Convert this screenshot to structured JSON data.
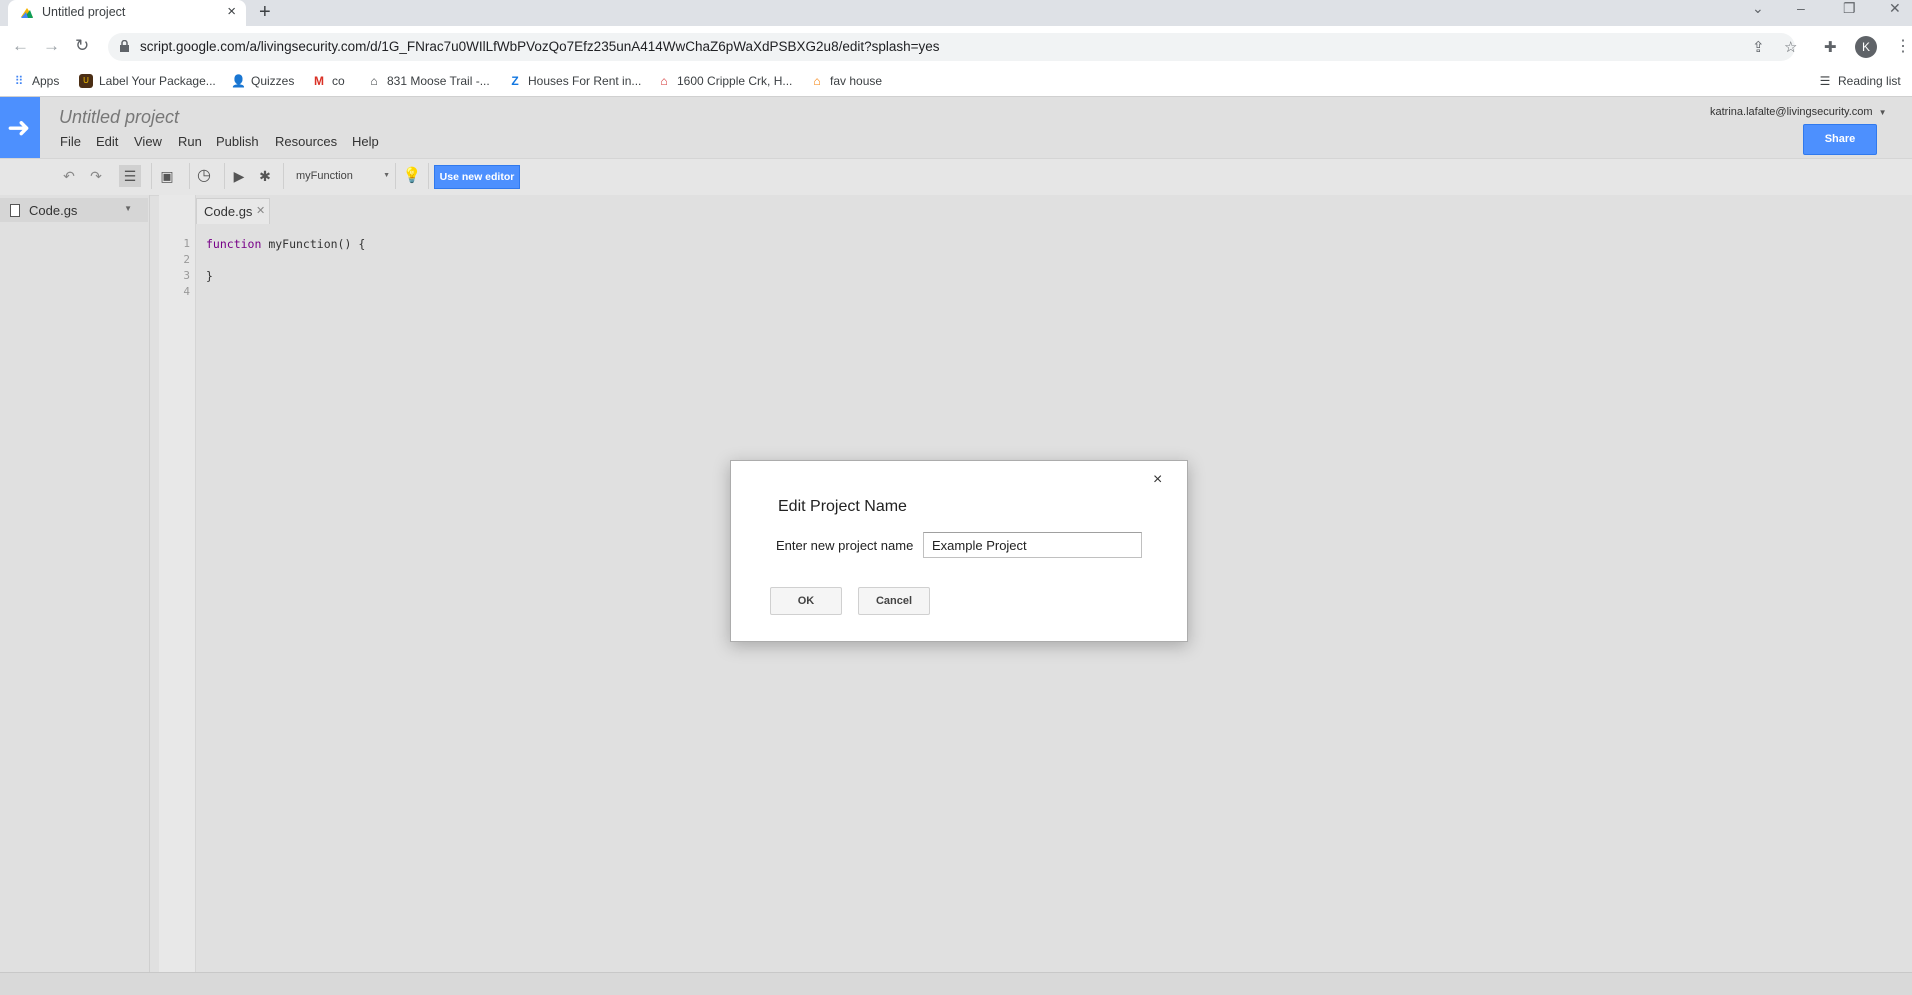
{
  "browser": {
    "tab_title": "Untitled project",
    "tab_close": "×",
    "new_tab": "+",
    "url": "script.google.com/a/livingsecurity.com/d/1G_FNrac7u0WIlLfWbPVozQo7Efz235unA414WwChaZ6pWaXdPSBXG2u8/edit?splash=yes",
    "profile_initial": "K",
    "window_controls": [
      "⌄",
      "–",
      "❐",
      "✕"
    ]
  },
  "bookmarks": {
    "apps": "Apps",
    "items": [
      "Label Your Package...",
      "Quizzes",
      "co",
      "831 Moose Trail -...",
      "Houses For Rent in...",
      "1600 Cripple Crk, H...",
      "fav house"
    ],
    "reading_list": "Reading list"
  },
  "app": {
    "project_title": "Untitled project",
    "menus": [
      "File",
      "Edit",
      "View",
      "Run",
      "Publish",
      "Resources",
      "Help"
    ],
    "user_email": "katrina.lafalte@livingsecurity.com",
    "share_label": "Share",
    "function_select": "myFunction",
    "new_editor_label": "Use new editor",
    "file_name": "Code.gs",
    "tab_name": "Code.gs",
    "line_numbers": [
      "1",
      "2",
      "3",
      "4"
    ],
    "code_line1_keyword": "function",
    "code_line1_rest": " myFunction() {",
    "code_line3": "}"
  },
  "dialog": {
    "title": "Edit Project Name",
    "label": "Enter new project name",
    "input_value": "Example Project",
    "ok_label": "OK",
    "cancel_label": "Cancel",
    "close": "×"
  },
  "colors": {
    "accent": "#4d90fe",
    "page_bg": "#e0e0e0"
  }
}
